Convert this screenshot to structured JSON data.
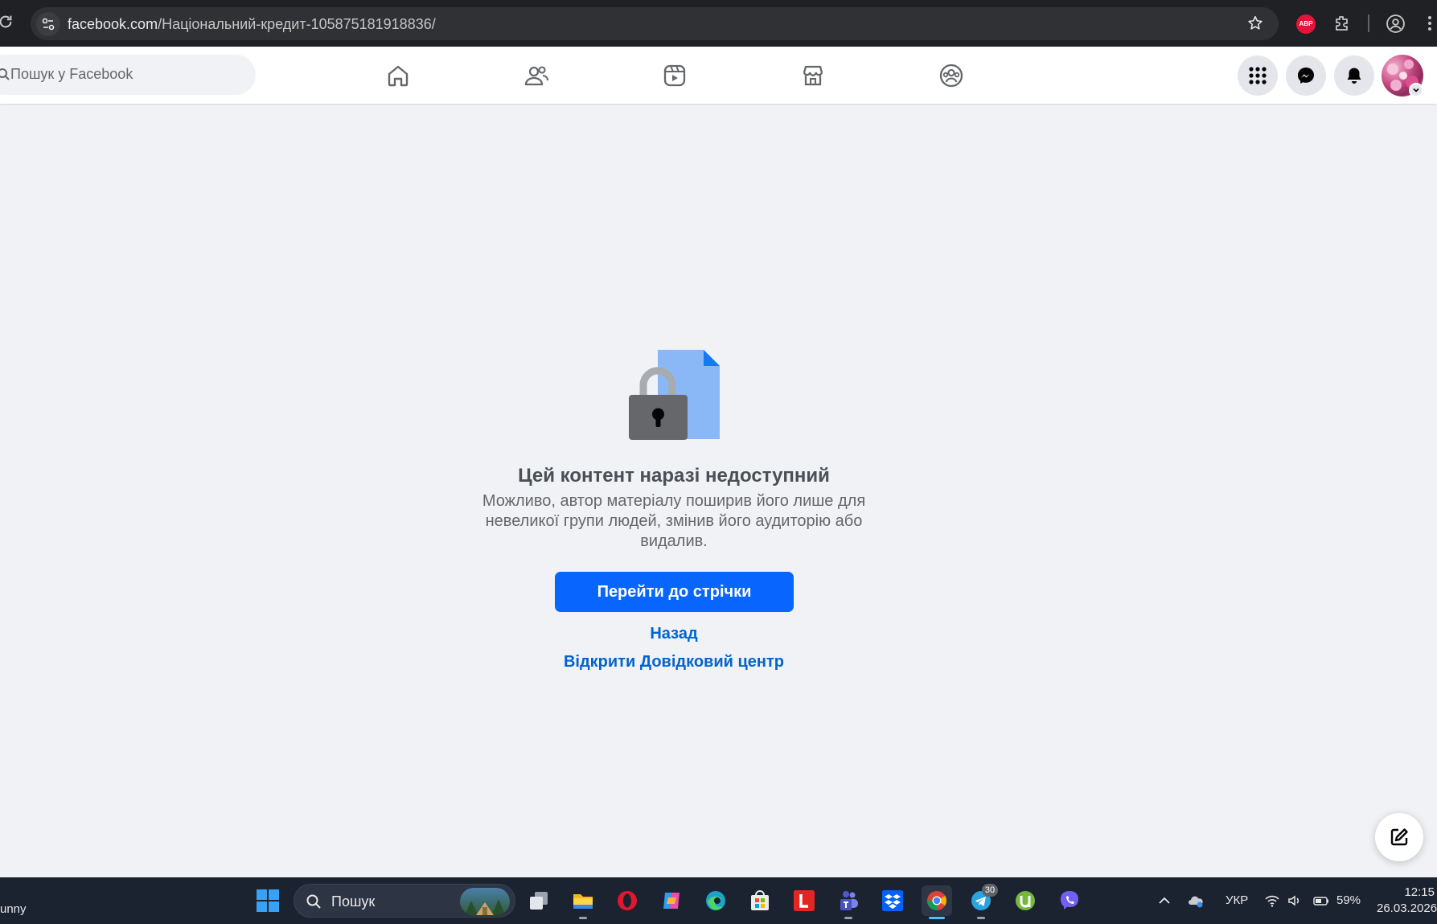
{
  "browser": {
    "url_host": "facebook.com",
    "url_path": "/Національний-кредит-105875181918836/",
    "extension_label": "ABP"
  },
  "header": {
    "search_placeholder": "Пошук у Facebook",
    "nav": [
      "home",
      "friends",
      "video",
      "marketplace",
      "groups"
    ],
    "accent": "#0866ff"
  },
  "content": {
    "title": "Цей контент наразі недоступний",
    "description": "Можливо, автор матеріалу поширив його лише для невеликої групи людей, змінив його аудиторію або видалив.",
    "primary_button": "Перейти до стрічки",
    "back_link": "Назад",
    "help_link": "Відкрити Довідковий центр"
  },
  "taskbar": {
    "weather_text": "unny",
    "search_label": "Пошук",
    "telegram_badge": "30",
    "language": "УКР",
    "battery": "59%",
    "time": "12:15",
    "date": "26.03.2026"
  }
}
